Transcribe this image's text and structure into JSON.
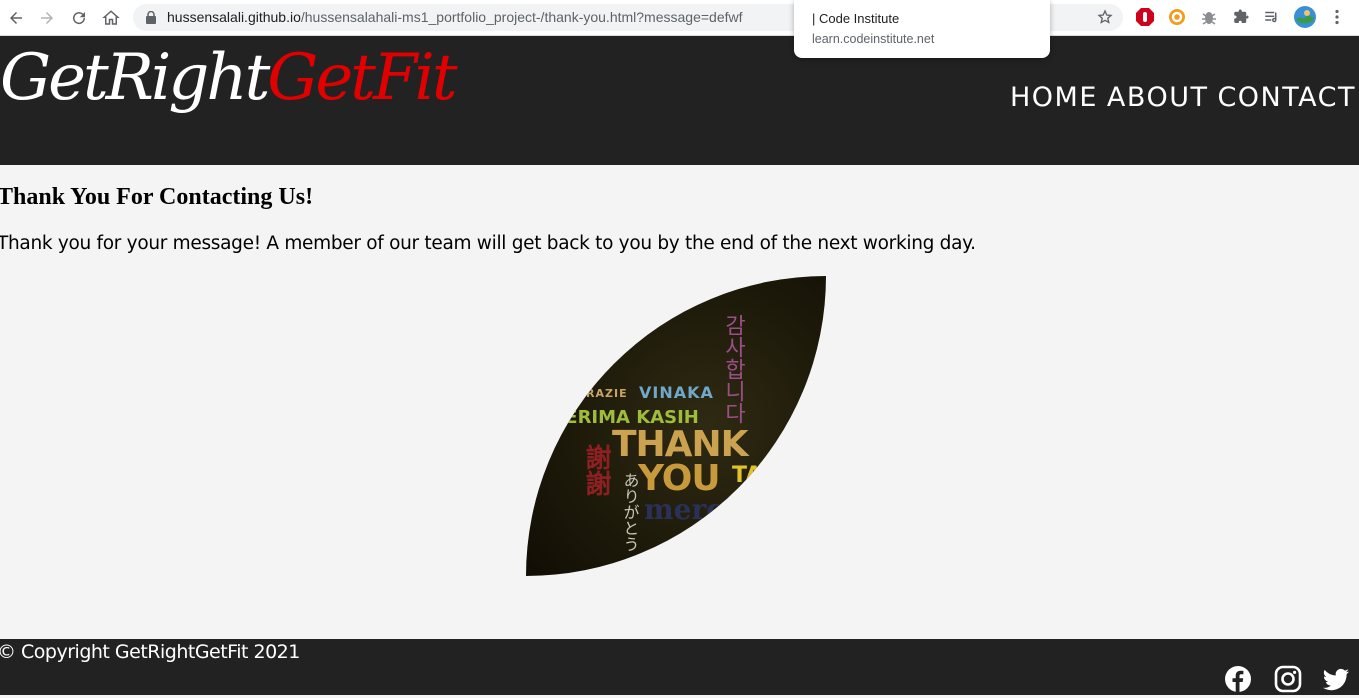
{
  "browser": {
    "url_host": "hussensalali.github.io",
    "url_path": "/hussensalahali-ms1_portfolio_project-/thank-you.html?message=defwf"
  },
  "tooltip": {
    "title": "| Code Institute",
    "url": "learn.codeinstitute.net"
  },
  "header": {
    "logo_part1": "GetRight",
    "logo_part2": "GetFit",
    "nav": [
      "HOME",
      "ABOUT",
      "CONTACT"
    ]
  },
  "main": {
    "heading": "Thank You For Contacting Us!",
    "message": "Thank you for your message! A member of our team will get back to you by the end of the next working day.",
    "image_words": {
      "korean": "감사합니다",
      "grazie": "GRAZIE",
      "vinaka": "VINAKA",
      "terima": "TERIMA KASIH",
      "thank": "THANK",
      "you": "YOU",
      "takk": "TAKK",
      "chinese": "謝謝",
      "japanese": "ありがとう",
      "merci": "merci"
    }
  },
  "footer": {
    "copyright": "© Copyright GetRightGetFit 2021",
    "social": [
      "facebook-icon",
      "instagram-icon",
      "twitter-icon"
    ]
  },
  "colors": {
    "header_bg": "#222222",
    "page_bg": "#f4f4f4",
    "logo_accent": "#e00000"
  }
}
